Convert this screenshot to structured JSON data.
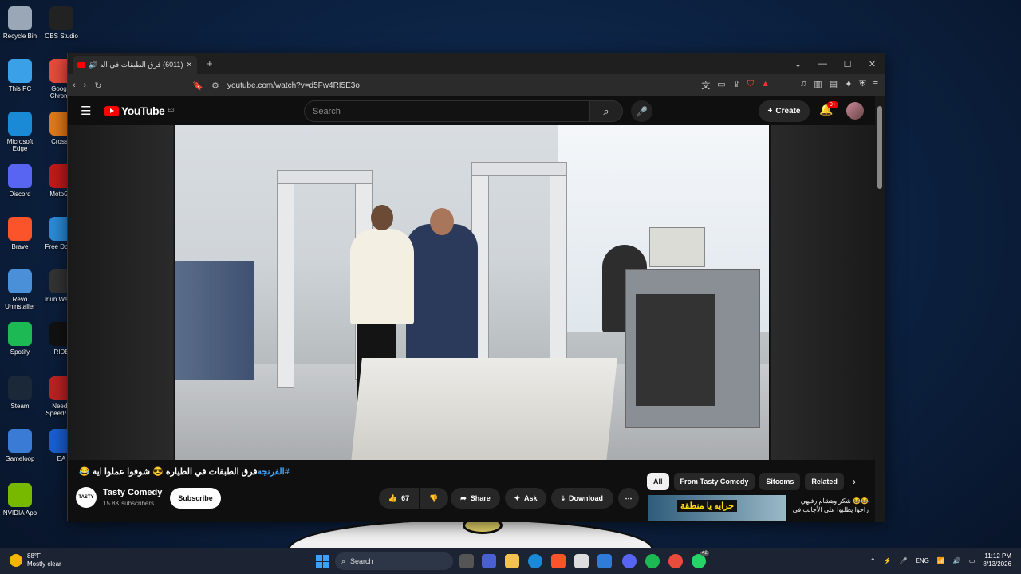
{
  "desktop": {
    "icons": [
      {
        "label": "Recycle Bin",
        "color": "#9aa7b6"
      },
      {
        "label": "OBS Studio",
        "color": "#222"
      },
      {
        "label": "This PC",
        "color": "#3aa0e8"
      },
      {
        "label": "Google Chrome",
        "color": "#e94b3c"
      },
      {
        "label": "Microsoft Edge",
        "color": "#1b8ad6"
      },
      {
        "label": "CrossF",
        "color": "#e07a1a"
      },
      {
        "label": "Discord",
        "color": "#5865f2"
      },
      {
        "label": "MotoGP",
        "color": "#c21a1a"
      },
      {
        "label": "Brave",
        "color": "#fb542b"
      },
      {
        "label": "Free Downl",
        "color": "#2b8ad6"
      },
      {
        "label": "Revo Uninstaller",
        "color": "#4a90d9"
      },
      {
        "label": "Iriun Webca",
        "color": "#333"
      },
      {
        "label": "Spotify",
        "color": "#1db954"
      },
      {
        "label": "RIDE",
        "color": "#111"
      },
      {
        "label": "Steam",
        "color": "#1b2838"
      },
      {
        "label": "Need f Speed™ H",
        "color": "#b22"
      },
      {
        "label": "Gameloop",
        "color": "#3a7bd5"
      },
      {
        "label": "EA",
        "color": "#1a5fd0"
      },
      {
        "label": "NVIDIA App",
        "color": "#76b900"
      }
    ]
  },
  "browser": {
    "tab_title": "(6011) فرق الطبقات في الطيارة",
    "new_tab": "+",
    "url": "youtube.com/watch?v=d5Fw4RI5E3o"
  },
  "youtube": {
    "logo": "YouTube",
    "region": "EG",
    "search_placeholder": "Search",
    "create_label": "Create",
    "notif_badge": "9+",
    "video_title_tag": "#الفرنجة",
    "video_title_rest": "فرق الطبقات في الطيارة 😎 شوفوا عملوا اية 😂",
    "channel_logo_text": "TASTY",
    "channel_name": "Tasty Comedy",
    "subscribers": "15.8K subscribers",
    "subscribe_label": "Subscribe",
    "likes": "67",
    "share_label": "Share",
    "ask_label": "Ask",
    "download_label": "Download",
    "chips": [
      "All",
      "From Tasty Comedy",
      "Sitcoms",
      "Related"
    ],
    "related_thumb_text": "جرايه يا منطقة",
    "related_title": "😂😂 شكر وهشام رفيهي راحوا يطلبوا على الأجانب في"
  },
  "taskbar": {
    "weather_temp": "88°F",
    "weather_desc": "Mostly clear",
    "search_label": "Search",
    "lang": "ENG",
    "time": "11:12 PM",
    "date": "8/13/2026",
    "whatsapp_badge": "42"
  }
}
